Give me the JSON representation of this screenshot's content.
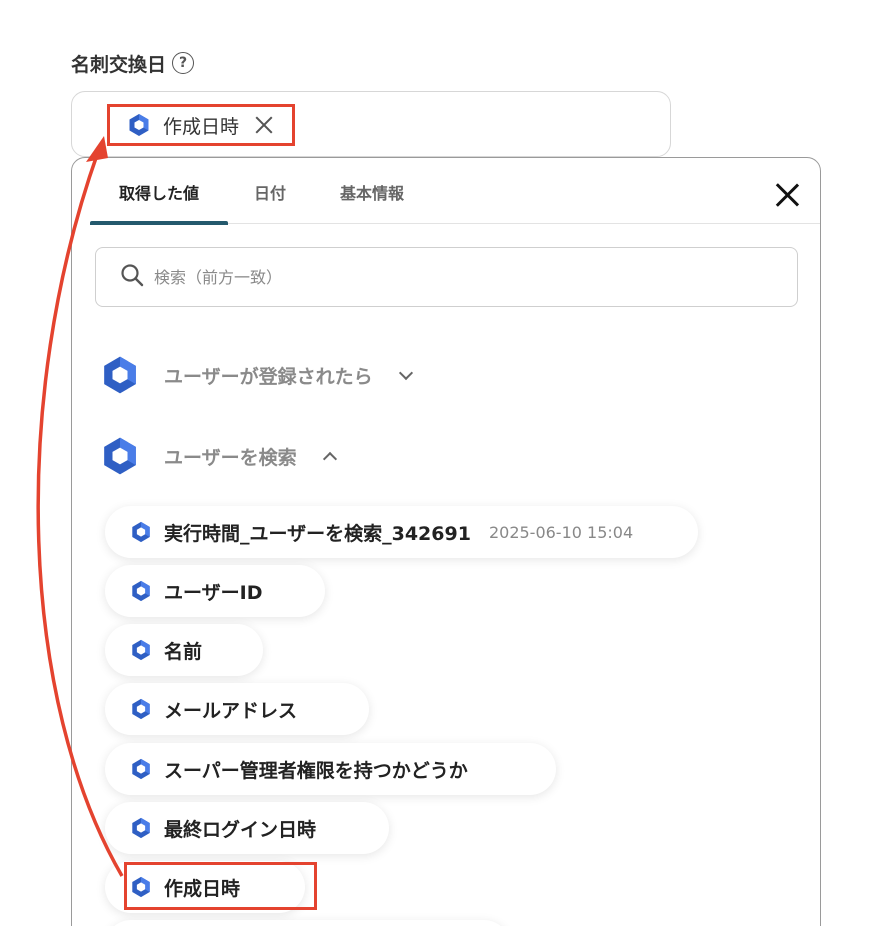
{
  "field": {
    "label": "名刺交換日",
    "help_icon": "?",
    "selected_chip": "作成日時"
  },
  "panel": {
    "tabs": [
      {
        "label": "取得した値",
        "active": true
      },
      {
        "label": "日付",
        "active": false
      },
      {
        "label": "基本情報",
        "active": false
      }
    ],
    "search_placeholder": "検索（前方一致）",
    "groups": [
      {
        "label": "ユーザーが登録されたら",
        "expanded": false
      },
      {
        "label": "ユーザーを検索",
        "expanded": true
      }
    ],
    "items": [
      {
        "label": "実行時間_ユーザーを検索_342691",
        "value": "2025-06-10 15:04"
      },
      {
        "label": "ユーザーID"
      },
      {
        "label": "名前"
      },
      {
        "label": "メールアドレス"
      },
      {
        "label": "スーパー管理者権限を持つかどうか"
      },
      {
        "label": "最終ログイン日時"
      },
      {
        "label": "作成日時"
      }
    ]
  },
  "colors": {
    "accent_red": "#e4432f",
    "tab_underline": "#24596d",
    "hex_blue": "#4a7de8",
    "hex_blue_dark": "#2f5fc4"
  },
  "icons": {
    "app_icon": "google-workspace-hex-icon",
    "close": "close-icon",
    "search": "search-icon"
  }
}
